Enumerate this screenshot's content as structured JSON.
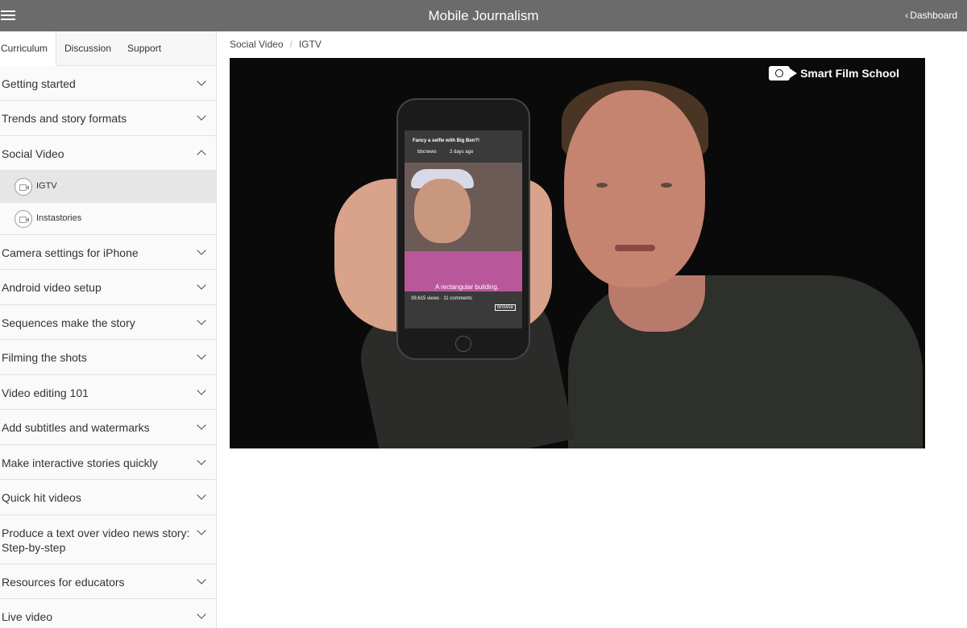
{
  "header": {
    "title": "Mobile Journalism",
    "dashboard_label": "Dashboard"
  },
  "sidebar": {
    "tabs": [
      {
        "label": "Curriculum",
        "active": true
      },
      {
        "label": "Discussion",
        "active": false
      },
      {
        "label": "Support",
        "active": false
      }
    ],
    "sections": [
      {
        "label": "Getting started",
        "expanded": false
      },
      {
        "label": "Trends and story formats",
        "expanded": false
      },
      {
        "label": "Social Video",
        "expanded": true,
        "lessons": [
          {
            "label": "IGTV",
            "active": true
          },
          {
            "label": "Instastories",
            "active": false
          }
        ]
      },
      {
        "label": "Camera settings for iPhone",
        "expanded": false
      },
      {
        "label": "Android video setup",
        "expanded": false
      },
      {
        "label": "Sequences make the story",
        "expanded": false
      },
      {
        "label": "Filming the shots",
        "expanded": false
      },
      {
        "label": "Video editing 101",
        "expanded": false
      },
      {
        "label": "Add subtitles and watermarks",
        "expanded": false
      },
      {
        "label": "Make interactive stories quickly",
        "expanded": false
      },
      {
        "label": "Quick hit videos",
        "expanded": false
      },
      {
        "label": "Produce a text over video news story: Step-by-step",
        "expanded": false
      },
      {
        "label": "Resources for educators",
        "expanded": false
      },
      {
        "label": "Live video",
        "expanded": false
      }
    ]
  },
  "breadcrumb": {
    "items": [
      "Social Video",
      "IGTV"
    ],
    "separator": "/"
  },
  "video": {
    "watermark": "Smart Film School",
    "phone_caption_title": "Fancy a selfie with Big Ben?!",
    "phone_account": "bbcnews",
    "phone_time": "2 days ago",
    "phone_subtitle": "A rectangular building.",
    "phone_stats": "39,615 views · 11 comments",
    "phone_browse": "Browse"
  },
  "colors": {
    "topbar": "#6b6b6b",
    "sidebar_bg": "#fafafa",
    "active_lesson_bg": "#e6e6e6"
  }
}
